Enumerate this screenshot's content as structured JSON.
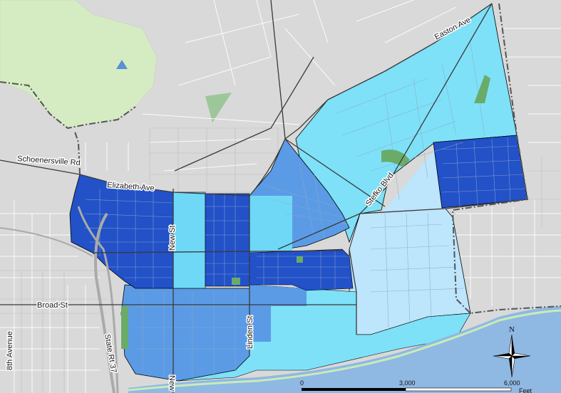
{
  "map": {
    "streets": {
      "easton": "Easton Ave",
      "schoenersville": "Schoenersville Rd",
      "elizabeth": "Elizabeth Ave",
      "new_st": "New St",
      "new_st_south": "New",
      "linden": "Linden St",
      "broad": "Broad St",
      "eighth": "8th Avenue",
      "stefko": "Stefko Blvd",
      "route": "State Rt 37"
    },
    "scale": {
      "ticks": [
        "0",
        "3,000",
        "6,000"
      ],
      "unit": "Feet"
    },
    "compass": {
      "north": "N"
    },
    "colors": {
      "background": "#d9d9d9",
      "park": "#d5ecc2",
      "river": "#8fb8e3",
      "darkest_blue": "#2251c8",
      "medium_blue": "#5b9be6",
      "light_cyan": "#6fd8f6",
      "lighter_cyan": "#7ee1f7",
      "palest_blue": "#bde5fb",
      "green_space": "#6aab6a"
    }
  }
}
